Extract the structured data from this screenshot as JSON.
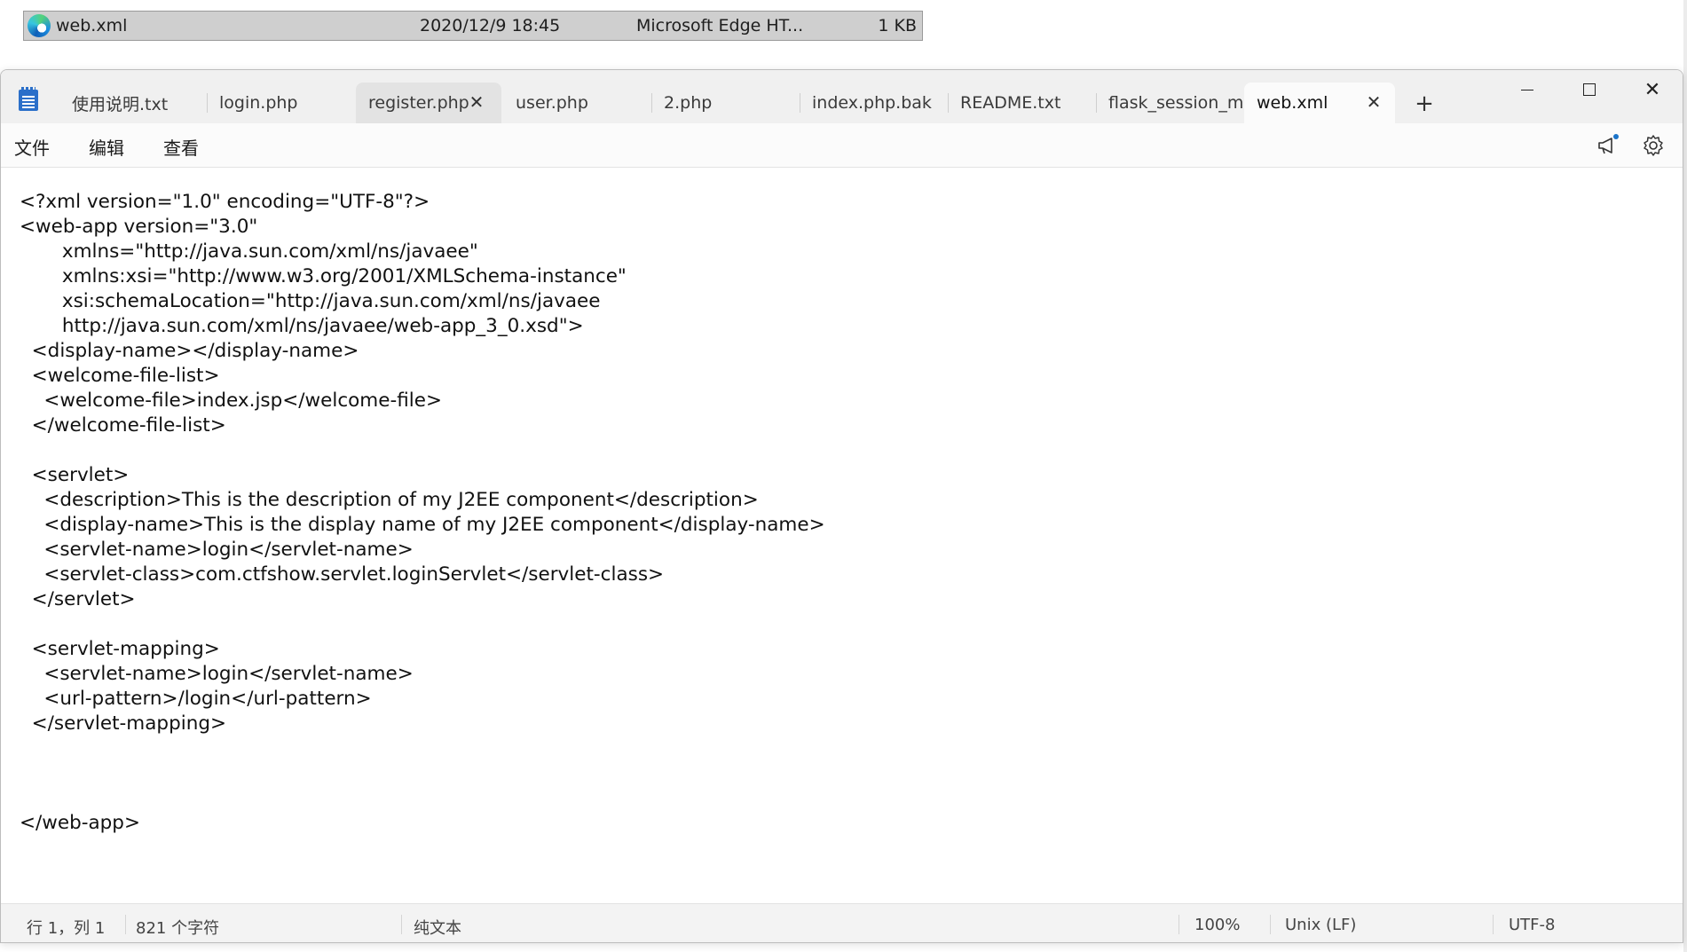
{
  "explorer": {
    "icon": "edge-icon",
    "name": "web.xml",
    "date": "2020/12/9 18:45",
    "type": "Microsoft Edge HT...",
    "size": "1 KB"
  },
  "window": {
    "app_icon": "notepad-icon",
    "tabs": [
      {
        "label": "使用说明.txt"
      },
      {
        "label": "login.php"
      },
      {
        "label": "register.php"
      },
      {
        "label": "user.php"
      },
      {
        "label": "2.php"
      },
      {
        "label": "index.php.bak"
      },
      {
        "label": "README.txt"
      },
      {
        "label": "flask_session_manager.py"
      },
      {
        "label": "web.xml"
      }
    ],
    "new_tab": "+",
    "close_glyph": "✕"
  },
  "menu": {
    "file": "文件",
    "edit": "编辑",
    "view": "查看"
  },
  "editor": {
    "content": "<?xml version=\"1.0\" encoding=\"UTF-8\"?>\n<web-app version=\"3.0\"\n       xmlns=\"http://java.sun.com/xml/ns/javaee\"\n       xmlns:xsi=\"http://www.w3.org/2001/XMLSchema-instance\"\n       xsi:schemaLocation=\"http://java.sun.com/xml/ns/javaee\n       http://java.sun.com/xml/ns/javaee/web-app_3_0.xsd\">\n  <display-name></display-name>\n  <welcome-file-list>\n    <welcome-file>index.jsp</welcome-file>\n  </welcome-file-list>\n\n  <servlet>\n    <description>This is the description of my J2EE component</description>\n    <display-name>This is the display name of my J2EE component</display-name>\n    <servlet-name>login</servlet-name>\n    <servlet-class>com.ctfshow.servlet.loginServlet</servlet-class>\n  </servlet>\n\n  <servlet-mapping>\n    <servlet-name>login</servlet-name>\n    <url-pattern>/login</url-pattern>\n  </servlet-mapping>\n\n\n\n</web-app>"
  },
  "status": {
    "position": "行 1，列 1",
    "chars": "821 个字符",
    "format": "纯文本",
    "zoom": "100%",
    "eol": "Unix (LF)",
    "encoding": "UTF-8"
  }
}
